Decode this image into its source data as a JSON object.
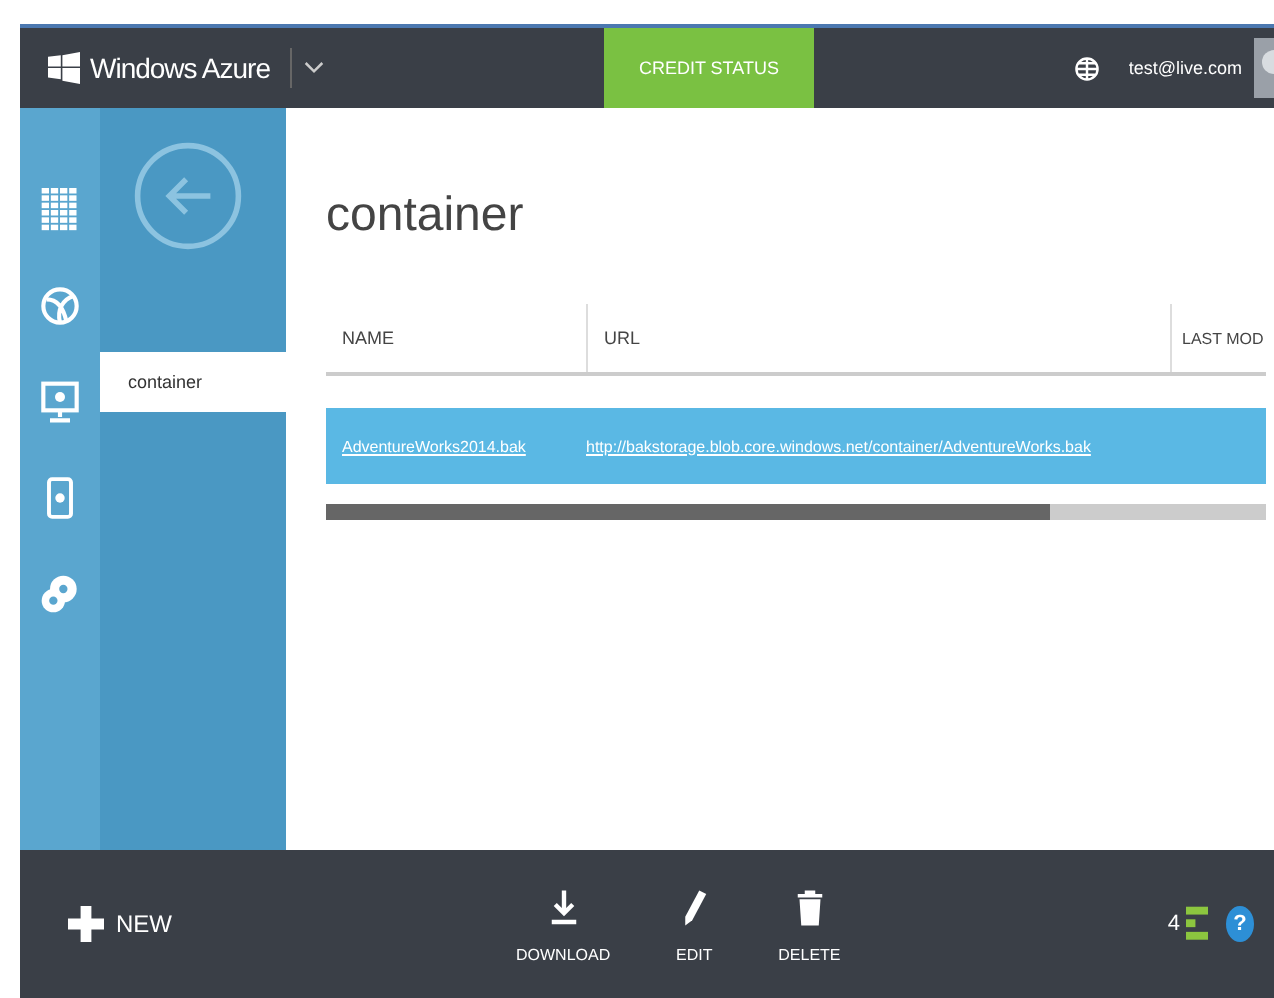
{
  "header": {
    "brand": "Windows Azure",
    "credit_status": "CREDIT STATUS",
    "user": "test@live.com"
  },
  "nav": {
    "items": [
      {
        "label": "container",
        "selected": true
      }
    ]
  },
  "page": {
    "title": "container"
  },
  "table": {
    "columns": [
      "NAME",
      "URL",
      "LAST MOD"
    ],
    "rows": [
      {
        "cells": [
          "AdventureWorks2014.bak",
          "http://bakstorage.blob.core.windows.net/container/AdventureWorks.bak"
        ],
        "selected": true
      }
    ]
  },
  "command_bar": {
    "new": "NEW",
    "actions": [
      {
        "kind": "download",
        "label": "DOWNLOAD"
      },
      {
        "kind": "edit",
        "label": "EDIT"
      },
      {
        "kind": "delete",
        "label": "DELETE"
      }
    ],
    "count": "4",
    "help": "?"
  }
}
